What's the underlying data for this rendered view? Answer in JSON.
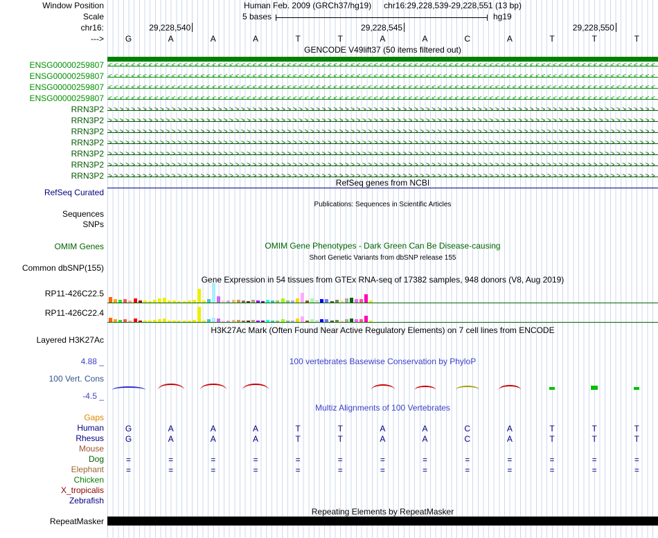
{
  "header": {
    "window_position_label": "Window Position",
    "assembly_text": "Human Feb. 2009 (GRCh37/hg19)",
    "position_text": "chr16:29,228,539-29,228,551 (13 bp)",
    "scale_label": "Scale",
    "scale_text": "5 bases",
    "assembly_short": "hg19",
    "chrom_label": "chr16:",
    "strand_label": "--->",
    "coordinates": [
      {
        "text": "29,228,540",
        "slot": 1
      },
      {
        "text": "29,228,545",
        "slot": 6
      },
      {
        "text": "29,228,550",
        "slot": 11
      }
    ],
    "bases": [
      "G",
      "A",
      "A",
      "A",
      "T",
      "T",
      "A",
      "A",
      "C",
      "A",
      "T",
      "T",
      "T"
    ]
  },
  "gencode": {
    "title": "GENCODE V49lift37 (50 items filtered out)",
    "bar_color": "#008000",
    "rows": [
      {
        "label": "ENSG00000259807",
        "arrow": "<",
        "color": "#009000"
      },
      {
        "label": "ENSG00000259807",
        "arrow": "<",
        "color": "#009000"
      },
      {
        "label": "ENSG00000259807",
        "arrow": "<",
        "color": "#009000"
      },
      {
        "label": "ENSG00000259807",
        "arrow": "<",
        "color": "#009000"
      },
      {
        "label": "RRN3P2",
        "arrow": ">",
        "color": "#005a00"
      },
      {
        "label": "RRN3P2",
        "arrow": ">",
        "color": "#005a00"
      },
      {
        "label": "RRN3P2",
        "arrow": ">",
        "color": "#005a00"
      },
      {
        "label": "RRN3P2",
        "arrow": ">",
        "color": "#005a00"
      },
      {
        "label": "RRN3P2",
        "arrow": ">",
        "color": "#005a00"
      },
      {
        "label": "RRN3P2",
        "arrow": ">",
        "color": "#005a00"
      },
      {
        "label": "RRN3P2",
        "arrow": ">",
        "color": "#005a00"
      }
    ]
  },
  "refseq": {
    "title": "RefSeq genes from NCBI",
    "track_label": "RefSeq Curated",
    "color": "#000080"
  },
  "publications": {
    "title": "Publications: Sequences in Scientific Articles"
  },
  "misc_labels": {
    "sequences": "Sequences",
    "snps": "SNPs"
  },
  "omim": {
    "title": "OMIM Gene Phenotypes - Dark Green Can Be Disease-causing",
    "track_label": "OMIM Genes",
    "color": "#006400"
  },
  "dbsnp": {
    "title": "Short Genetic Variants from dbSNP release 155",
    "track_label": "Common dbSNP(155)"
  },
  "gtex": {
    "title": "Gene Expression in 54 tissues from GTEx RNA-seq of 17382 samples, 948 donors (V8, Aug 2019)",
    "axis_color": "#006400",
    "charts": [
      {
        "label": "RP11-426C22.5",
        "bars": [
          [
            "#FF6600",
            8
          ],
          [
            "#FFAA00",
            5
          ],
          [
            "#33DD33",
            4
          ],
          [
            "#FF5555",
            5
          ],
          [
            "#FFAA99",
            3
          ],
          [
            "#FF0000",
            6
          ],
          [
            "#AA0000",
            3
          ],
          [
            "#EEEE00",
            3
          ],
          [
            "#EEEE00",
            2
          ],
          [
            "#EEEE00",
            4
          ],
          [
            "#EEEE00",
            6
          ],
          [
            "#EEEE00",
            7
          ],
          [
            "#EEEE00",
            3
          ],
          [
            "#EEEE00",
            3
          ],
          [
            "#EEEE00",
            2
          ],
          [
            "#EEEE00",
            2
          ],
          [
            "#EEEE00",
            3
          ],
          [
            "#EEEE00",
            4
          ],
          [
            "#EEEE00",
            20
          ],
          [
            "#EEEE00",
            3
          ],
          [
            "#33CCCC",
            5
          ],
          [
            "#AAEEFF",
            28
          ],
          [
            "#CC66FF",
            9
          ],
          [
            "#FFCCCC",
            3
          ],
          [
            "#CCAADD",
            3
          ],
          [
            "#EEBB77",
            4
          ],
          [
            "#CC9955",
            4
          ],
          [
            "#8B7355",
            3
          ],
          [
            "#663300",
            2
          ],
          [
            "#BB9988",
            4
          ],
          [
            "#9900FF",
            3
          ],
          [
            "#660099",
            2
          ],
          [
            "#22FFDD",
            4
          ],
          [
            "#33CCAA",
            3
          ],
          [
            "#AABB66",
            3
          ],
          [
            "#99FF00",
            6
          ],
          [
            "#99BB88",
            3
          ],
          [
            "#AAAAFF",
            3
          ],
          [
            "#FFD700",
            6
          ],
          [
            "#FFAAFF",
            14
          ],
          [
            "#995522",
            3
          ],
          [
            "#AAFF99",
            6
          ],
          [
            "#DDDDDD",
            4
          ],
          [
            "#0000FF",
            5
          ],
          [
            "#7777FF",
            5
          ],
          [
            "#555522",
            2
          ],
          [
            "#778855",
            4
          ],
          [
            "#FFDD99",
            3
          ],
          [
            "#AAAAAA",
            6
          ],
          [
            "#006600",
            7
          ],
          [
            "#FF66FF",
            5
          ],
          [
            "#FF5599",
            5
          ],
          [
            "#FF00BB",
            12
          ],
          [
            "#EEEE00",
            3
          ]
        ]
      },
      {
        "label": "RP11-426C22.4",
        "bars": [
          [
            "#FF6600",
            6
          ],
          [
            "#FFAA00",
            4
          ],
          [
            "#33DD33",
            3
          ],
          [
            "#FF5555",
            4
          ],
          [
            "#FFAA99",
            2
          ],
          [
            "#FF0000",
            5
          ],
          [
            "#AA0000",
            2
          ],
          [
            "#EEEE00",
            2
          ],
          [
            "#EEEE00",
            2
          ],
          [
            "#EEEE00",
            3
          ],
          [
            "#EEEE00",
            4
          ],
          [
            "#EEEE00",
            5
          ],
          [
            "#EEEE00",
            2
          ],
          [
            "#EEEE00",
            2
          ],
          [
            "#EEEE00",
            2
          ],
          [
            "#EEEE00",
            2
          ],
          [
            "#EEEE00",
            2
          ],
          [
            "#EEEE00",
            3
          ],
          [
            "#EEEE00",
            22
          ],
          [
            "#EEEE00",
            2
          ],
          [
            "#33CCCC",
            4
          ],
          [
            "#AAEEFF",
            6
          ],
          [
            "#CC66FF",
            5
          ],
          [
            "#FFCCCC",
            2
          ],
          [
            "#CCAADD",
            2
          ],
          [
            "#EEBB77",
            3
          ],
          [
            "#CC9955",
            3
          ],
          [
            "#8B7355",
            2
          ],
          [
            "#663300",
            2
          ],
          [
            "#BB9988",
            3
          ],
          [
            "#9900FF",
            2
          ],
          [
            "#660099",
            2
          ],
          [
            "#22FFDD",
            3
          ],
          [
            "#33CCAA",
            2
          ],
          [
            "#AABB66",
            2
          ],
          [
            "#99FF00",
            4
          ],
          [
            "#99BB88",
            2
          ],
          [
            "#AAAAFF",
            2
          ],
          [
            "#FFD700",
            5
          ],
          [
            "#FFAAFF",
            8
          ],
          [
            "#995522",
            2
          ],
          [
            "#AAFF99",
            4
          ],
          [
            "#DDDDDD",
            3
          ],
          [
            "#0000FF",
            4
          ],
          [
            "#7777FF",
            4
          ],
          [
            "#555522",
            2
          ],
          [
            "#778855",
            3
          ],
          [
            "#FFDD99",
            2
          ],
          [
            "#AAAAAA",
            4
          ],
          [
            "#006600",
            5
          ],
          [
            "#FF66FF",
            4
          ],
          [
            "#FF5599",
            4
          ],
          [
            "#FF00BB",
            9
          ],
          [
            "#EEEE00",
            2
          ]
        ]
      }
    ]
  },
  "encode": {
    "title": "H3K27Ac Mark (Often Found Near Active Regulatory Elements) on 7 cell lines from ENCODE",
    "track_label": "Layered H3K27Ac"
  },
  "phylop": {
    "title": "100 vertebrates Basewise Conservation by PhyloP",
    "track_label": "100 Vert. Cons",
    "max_label": "4.88 _",
    "min_label": "-4.5 _",
    "items": [
      {
        "slot": 0,
        "kind": "arc",
        "color": "#2b2bd0",
        "w": 48,
        "h": 5
      },
      {
        "slot": 1,
        "kind": "arc",
        "color": "#cc0000",
        "w": 38,
        "h": 9
      },
      {
        "slot": 2,
        "kind": "arc",
        "color": "#cc0000",
        "w": 38,
        "h": 9
      },
      {
        "slot": 3,
        "kind": "arc",
        "color": "#cc0000",
        "w": 38,
        "h": 9
      },
      {
        "slot": 6,
        "kind": "arc",
        "color": "#cc0000",
        "w": 34,
        "h": 8
      },
      {
        "slot": 7,
        "kind": "arc",
        "color": "#cc0000",
        "w": 30,
        "h": 6
      },
      {
        "slot": 8,
        "kind": "arc",
        "color": "#a0a000",
        "w": 34,
        "h": 6
      },
      {
        "slot": 9,
        "kind": "arc",
        "color": "#cc0000",
        "w": 32,
        "h": 7
      },
      {
        "slot": 10,
        "kind": "tick",
        "color": "#00c000",
        "w": 8,
        "h": 4
      },
      {
        "slot": 11,
        "kind": "tick",
        "color": "#00c000",
        "w": 10,
        "h": 6
      },
      {
        "slot": 12,
        "kind": "tick",
        "color": "#00c000",
        "w": 8,
        "h": 4
      }
    ]
  },
  "multiz": {
    "title": "Multiz Alignments of 100 Vertebrates",
    "cell_color": "#000080",
    "rows": [
      {
        "label": "Gaps",
        "color": "#dd8800",
        "cells": []
      },
      {
        "label": "Human",
        "color": "#000080",
        "cells": [
          "G",
          "A",
          "A",
          "A",
          "T",
          "T",
          "A",
          "A",
          "C",
          "A",
          "T",
          "T",
          "T"
        ]
      },
      {
        "label": "Rhesus",
        "color": "#000080",
        "cells": [
          "G",
          "A",
          "A",
          "A",
          "T",
          "T",
          "A",
          "A",
          "C",
          "A",
          "T",
          "T",
          "T"
        ]
      },
      {
        "label": "Mouse",
        "color": "#a0522d",
        "cells": []
      },
      {
        "label": "Dog",
        "color": "#006400",
        "cells": [
          "=",
          "=",
          "=",
          "=",
          "=",
          "=",
          "=",
          "=",
          "=",
          "=",
          "=",
          "=",
          "="
        ]
      },
      {
        "label": "Elephant",
        "color": "#996633",
        "cells": [
          "=",
          "=",
          "=",
          "=",
          "=",
          "=",
          "=",
          "=",
          "=",
          "=",
          "=",
          "=",
          "="
        ]
      },
      {
        "label": "Chicken",
        "color": "#008000",
        "cells": []
      },
      {
        "label": "X_tropicalis",
        "color": "#8b0000",
        "cells": []
      },
      {
        "label": "Zebrafish",
        "color": "#000080",
        "cells": []
      }
    ]
  },
  "repeatmasker": {
    "title": "Repeating Elements by RepeatMasker",
    "track_label": "RepeatMasker",
    "bar_color": "#000000"
  }
}
